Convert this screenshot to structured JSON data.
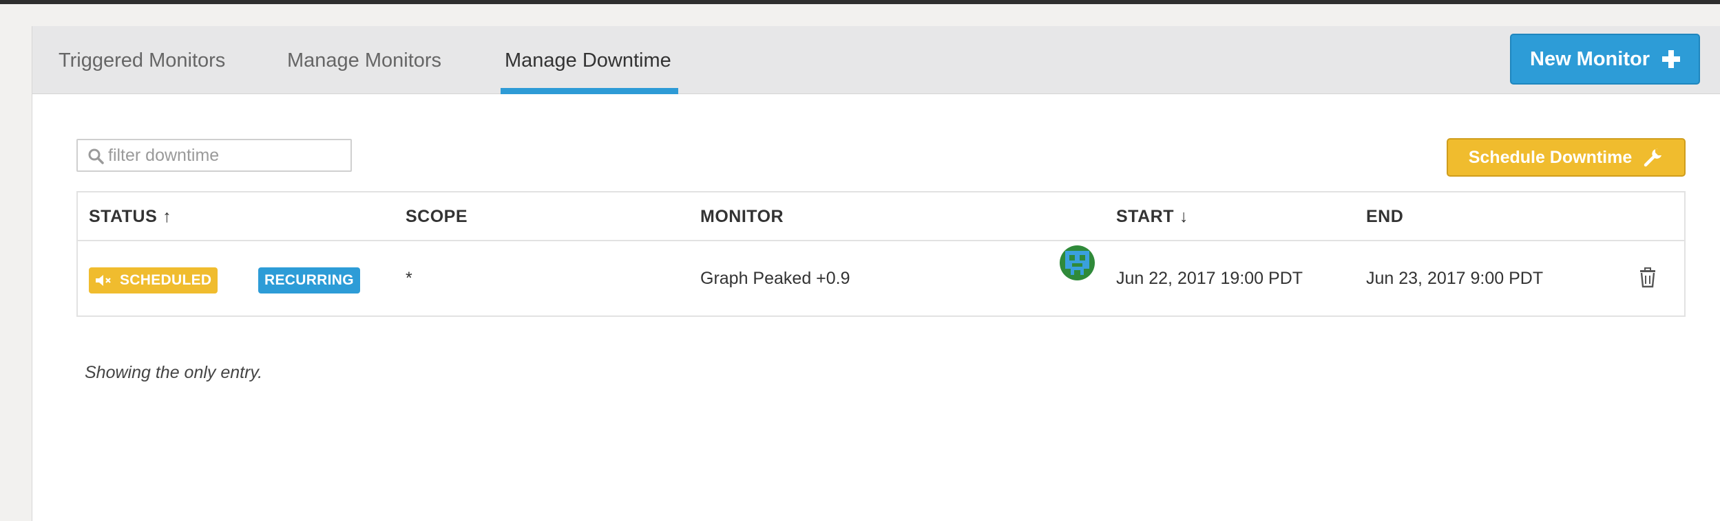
{
  "tabs": [
    {
      "label": "Triggered Monitors",
      "active": false
    },
    {
      "label": "Manage Monitors",
      "active": false
    },
    {
      "label": "Manage Downtime",
      "active": true
    }
  ],
  "header": {
    "new_monitor_label": "New Monitor",
    "new_monitor_icon": "plus-icon"
  },
  "filter": {
    "placeholder": "filter downtime",
    "value": "",
    "icon": "search-icon"
  },
  "schedule_button": {
    "label": "Schedule Downtime",
    "icon": "wrench-icon"
  },
  "table": {
    "columns": [
      {
        "label": "STATUS",
        "sort": "↑"
      },
      {
        "label": "SCOPE",
        "sort": ""
      },
      {
        "label": "MONITOR",
        "sort": ""
      },
      {
        "label": "START",
        "sort": "↓"
      },
      {
        "label": "END",
        "sort": ""
      }
    ],
    "rows": [
      {
        "status": "SCHEDULED",
        "status_icon": "muted-speaker-icon",
        "type": "RECURRING",
        "scope": "*",
        "monitor": "Graph Peaked +0.9",
        "avatar": "user-avatar",
        "start": "Jun 22, 2017 19:00 PDT",
        "end": "Jun 23, 2017 9:00 PDT",
        "delete_icon": "trash-icon"
      }
    ]
  },
  "footer": {
    "entries_text": "Showing the only entry."
  },
  "colors": {
    "accent_blue": "#2d9cd7",
    "accent_yellow": "#f0bc2e",
    "tabbar_bg": "#e7e7e8",
    "avatar_green": "#2f8a3a"
  }
}
